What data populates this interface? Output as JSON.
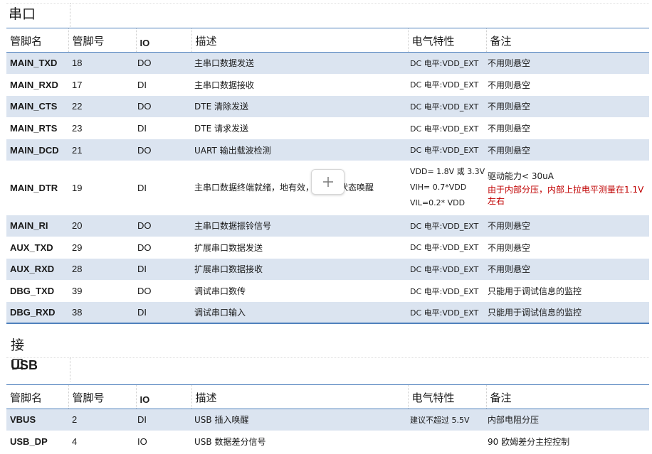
{
  "sections": [
    {
      "title_cjk": "串口",
      "title_latin": "",
      "headers": [
        "管脚名",
        "管脚号",
        "IO",
        "描述",
        "电气特性",
        "备注"
      ],
      "rows": [
        {
          "name": "MAIN_TXD",
          "num": "18",
          "io": "DO",
          "desc": "主串口数据发送",
          "elec": "DC 电平:VDD_EXT",
          "note": "不用则悬空"
        },
        {
          "name": "MAIN_RXD",
          "num": "17",
          "io": "DI",
          "desc": "主串口数据接收",
          "elec": "DC 电平:VDD_EXT",
          "note": "不用则悬空"
        },
        {
          "name": "MAIN_CTS",
          "num": "22",
          "io": "DO",
          "desc": "DTE 清除发送",
          "elec": "DC 电平:VDD_EXT",
          "note": "不用则悬空"
        },
        {
          "name": "MAIN_RTS",
          "num": "23",
          "io": "DI",
          "desc": "DTE 请求发送",
          "elec": "DC 电平:VDD_EXT",
          "note": "不用则悬空"
        },
        {
          "name": "MAIN_DCD",
          "num": "21",
          "io": "DO",
          "desc": "UART 输出载波检测",
          "elec": "DC 电平:VDD_EXT",
          "note": "不用则悬空"
        },
        {
          "name": "MAIN_DTR",
          "num": "19",
          "io": "DI",
          "desc": "主串口数据终端就绪，地有效，从休眠状态唤醒",
          "elec_lines": [
            "VDD= 1.8V 或 3.3V",
            "VIH= 0.7*VDD",
            "VIL=0.2* VDD"
          ],
          "note_black": "驱动能力< 30uA",
          "note_red": "由于内部分压，内部上拉电平测量在1.1V 左右"
        },
        {
          "name": "MAIN_RI",
          "num": "20",
          "io": "DO",
          "desc": "主串口数据振铃信号",
          "elec": "DC 电平:VDD_EXT",
          "note": "不用则悬空"
        },
        {
          "name": "AUX_TXD",
          "num": "29",
          "io": "DO",
          "desc": "扩展串口数据发送",
          "elec": "DC 电平:VDD_EXT",
          "note": "不用则悬空"
        },
        {
          "name": "AUX_RXD",
          "num": "28",
          "io": "DI",
          "desc": "扩展串口数据接收",
          "elec": "DC 电平:VDD_EXT",
          "note": "不用则悬空"
        },
        {
          "name": "DBG_TXD",
          "num": "39",
          "io": "DO",
          "desc": "调试串口数传",
          "elec": "DC 电平:VDD_EXT",
          "note": "只能用于调试信息的监控"
        },
        {
          "name": "DBG_RXD",
          "num": "38",
          "io": "DI",
          "desc": "调试串口输入",
          "elec": "DC 电平:VDD_EXT",
          "note": "只能用于调试信息的监控"
        }
      ]
    },
    {
      "title_cjk": "接口",
      "title_latin": "USB",
      "headers": [
        "管脚名",
        "管脚号",
        "IO",
        "描述",
        "电气特性",
        "备注"
      ],
      "rows": [
        {
          "name": "VBUS",
          "num": "2",
          "io": "DI",
          "desc": "USB 插入唤醒",
          "elec": "建议不超过  5.5V",
          "note": "内部电阻分压"
        },
        {
          "name": "USB_DP",
          "num": "4",
          "io": "IO",
          "desc": "USB 数据差分信号",
          "elec": "",
          "note": "90 欧姆差分主控控制"
        }
      ]
    }
  ],
  "floating_button": {
    "icon": "plus-icon"
  },
  "colors": {
    "row_alt": "#dbe4f0",
    "rule": "#4f81bd",
    "note_red": "#c00000"
  }
}
